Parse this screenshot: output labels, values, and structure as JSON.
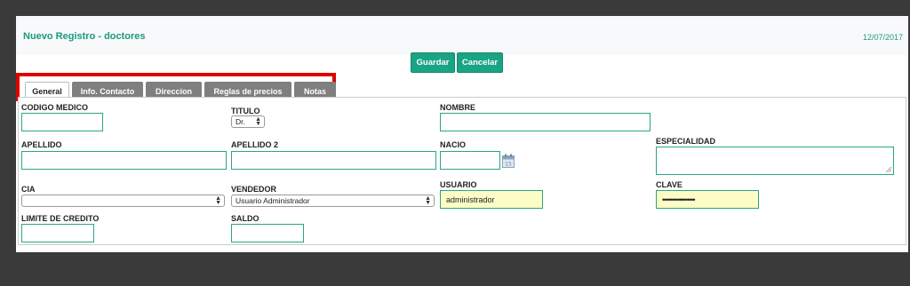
{
  "header": {
    "title": "Nuevo Registro - doctores",
    "date": "12/07/2017"
  },
  "toolbar": {
    "save_label": "Guardar",
    "cancel_label": "Cancelar"
  },
  "tabs": [
    {
      "label": "General",
      "active": true
    },
    {
      "label": "Info. Contacto",
      "active": false
    },
    {
      "label": "Direccion",
      "active": false
    },
    {
      "label": "Reglas de precios",
      "active": false
    },
    {
      "label": "Notas",
      "active": false
    }
  ],
  "form": {
    "codigo_medico": {
      "label": "CODIGO MEDICO",
      "value": ""
    },
    "titulo": {
      "label": "TITULO",
      "value": "Dr."
    },
    "nombre": {
      "label": "NOMBRE",
      "value": ""
    },
    "apellido": {
      "label": "APELLIDO",
      "value": ""
    },
    "apellido2": {
      "label": "APELLIDO 2",
      "value": ""
    },
    "nacio": {
      "label": "NACIO",
      "value": ""
    },
    "especialidad": {
      "label": "ESPECIALIDAD",
      "value": ""
    },
    "cia": {
      "label": "CIA",
      "value": ""
    },
    "vendedor": {
      "label": "VENDEDOR",
      "value": "Usuario Administrador"
    },
    "usuario": {
      "label": "USUARIO",
      "value": "administrador"
    },
    "clave": {
      "label": "CLAVE",
      "value": "•••••••••••••••••"
    },
    "limite_credito": {
      "label": "LIMITE DE CREDITO",
      "value": ""
    },
    "saldo": {
      "label": "SALDO",
      "value": ""
    }
  },
  "colors": {
    "accent": "#1aa384",
    "highlight_border": "#e00000",
    "tab_inactive": "#7f7f7f",
    "field_highlight": "#fcfcc4"
  }
}
